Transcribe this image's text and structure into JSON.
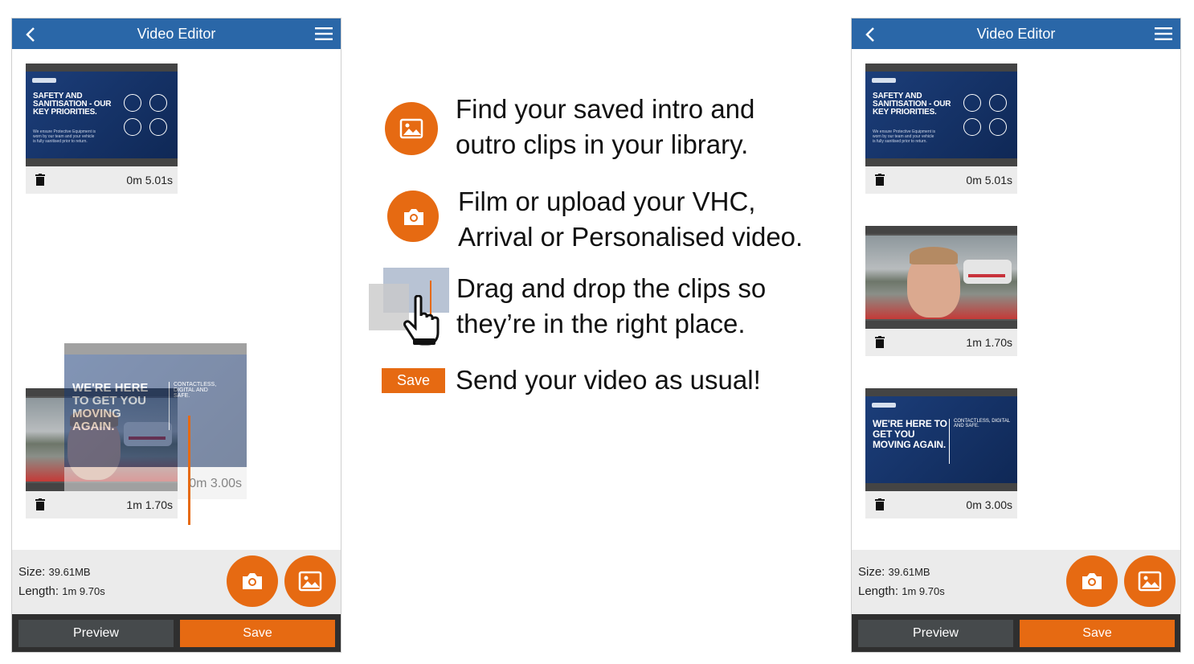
{
  "left_phone": {
    "header": {
      "title": "Video Editor",
      "back_icon": "chevron-left-icon",
      "menu_icon": "hamburger-icon"
    },
    "clips": [
      {
        "duration": "0m 5.01s",
        "type": "promo",
        "headline": "SAFETY AND SANITISATION - OUR KEY PRIORITIES.",
        "body": "We ensure Protective Equipment is worn by our team and your vehicle is fully sanitised prior to return."
      },
      {
        "duration": "1m 1.70s",
        "type": "video"
      }
    ],
    "dragging": {
      "duration": "0m 3.00s",
      "headline": "WE'RE HERE TO GET YOU MOVING AGAIN.",
      "tagline": "CONTACTLESS, DIGITAL AND SAFE."
    },
    "info": {
      "size_label": "Size:",
      "size_value": "39.61MB",
      "length_label": "Length:",
      "length_value": "1m 9.70s"
    },
    "buttons": {
      "preview": "Preview",
      "save": "Save"
    }
  },
  "right_phone": {
    "header": {
      "title": "Video Editor",
      "back_icon": "chevron-left-icon",
      "menu_icon": "hamburger-icon"
    },
    "clips": [
      {
        "duration": "0m 5.01s",
        "type": "promo",
        "headline": "SAFETY AND SANITISATION - OUR KEY PRIORITIES.",
        "body": "We ensure Protective Equipment is worn by our team and your vehicle is fully sanitised prior to return."
      },
      {
        "duration": "1m 1.70s",
        "type": "video"
      },
      {
        "duration": "0m 3.00s",
        "type": "promo2",
        "headline": "WE'RE HERE TO GET YOU MOVING AGAIN.",
        "tagline": "CONTACTLESS, DIGITAL AND SAFE."
      }
    ],
    "info": {
      "size_label": "Size:",
      "size_value": "39.61MB",
      "length_label": "Length:",
      "length_value": "1m 9.70s"
    },
    "buttons": {
      "preview": "Preview",
      "save": "Save"
    }
  },
  "instructions": [
    {
      "icon": "image-library-icon",
      "line1": "Find your saved intro and",
      "line2": "outro clips in your library."
    },
    {
      "icon": "camera-icon",
      "line1": "Film or upload your VHC,",
      "line2": "Arrival or Personalised video."
    },
    {
      "icon": "drag-hand-icon",
      "line1": "Drag and drop the clips so",
      "line2": "they’re in the right place."
    },
    {
      "icon": "save-badge",
      "badge": "Save",
      "line1": "Send your video as usual!"
    }
  ],
  "colors": {
    "accent": "#e66a12",
    "header": "#2a67a8",
    "promo_blue": "#1c3e7a",
    "bottom_bar": "#2f2f2f"
  }
}
